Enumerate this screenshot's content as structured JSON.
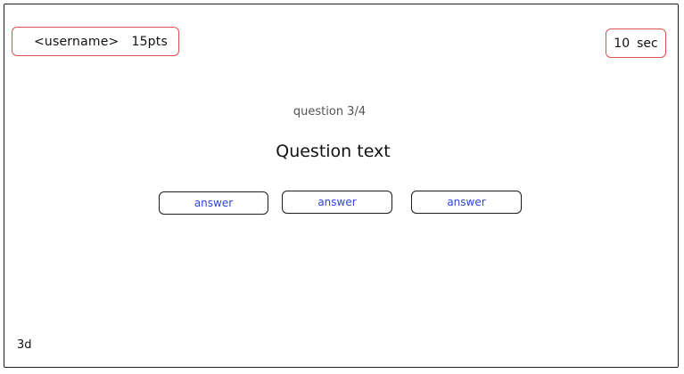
{
  "header": {
    "username": "<username>",
    "points": "15pts",
    "timer_value": "10",
    "timer_unit": "sec"
  },
  "quiz": {
    "counter": "question 3/4",
    "question_text": "Question text",
    "answers": [
      "answer",
      "answer",
      "answer"
    ]
  },
  "footer": {
    "note": "3d"
  },
  "colors": {
    "status_border": "#d9534f",
    "answer_text": "#2f45d8",
    "frame_border": "#1b1b1b"
  }
}
